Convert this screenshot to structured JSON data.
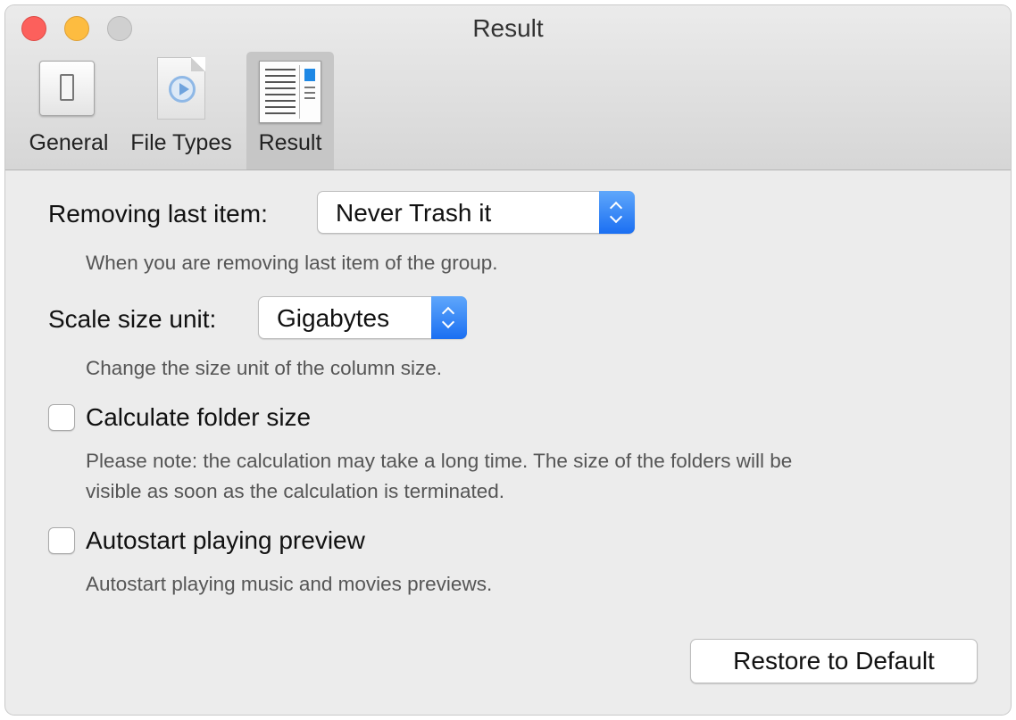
{
  "window": {
    "title": "Result"
  },
  "toolbar": {
    "tabs": [
      {
        "label": "General",
        "icon": "toggle-switch-icon"
      },
      {
        "label": "File Types",
        "icon": "media-file-icon"
      },
      {
        "label": "Result",
        "icon": "result-list-icon",
        "selected": true
      }
    ]
  },
  "settings": {
    "removing_last_item": {
      "label": "Removing last item:",
      "value": "Never Trash it",
      "description": "When you are removing last item of the group."
    },
    "scale_size_unit": {
      "label": "Scale size unit:",
      "value": "Gigabytes",
      "description": "Change the size unit of the column size."
    },
    "calculate_folder_size": {
      "label": "Calculate folder size",
      "checked": false,
      "description_line1": "Please note: the calculation may take a long time. The size of the folders will be",
      "description_line2": "visible as soon as the calculation is terminated."
    },
    "autostart_preview": {
      "label": "Autostart playing preview",
      "checked": false,
      "description": "Autostart playing music and movies previews."
    }
  },
  "footer": {
    "restore_label": "Restore to Default"
  },
  "colors": {
    "close": "#fc605c",
    "minimize": "#fdbc40",
    "zoom_disabled": "#d0d0d0",
    "accent": "#1b6ff2"
  }
}
